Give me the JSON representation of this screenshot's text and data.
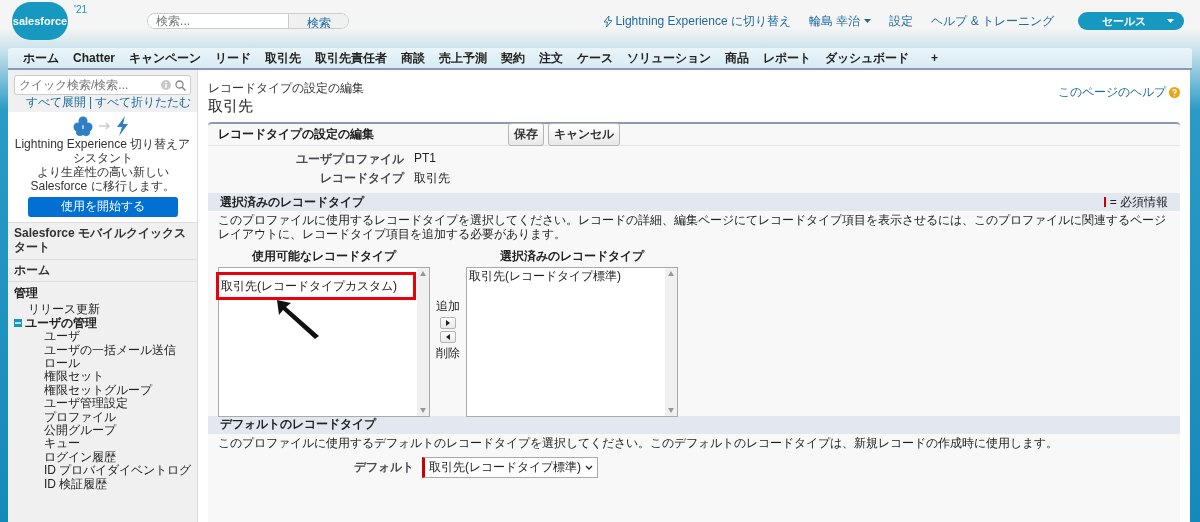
{
  "header": {
    "logo": "salesforce",
    "logo_badge": "'21",
    "search": {
      "placeholder": "検索...",
      "button": "検索"
    },
    "links": [
      {
        "kind": "lightning",
        "label": "Lightning Experience に切り替え"
      },
      {
        "kind": "user",
        "label": "輪島 幸治"
      },
      {
        "kind": "plain",
        "label": "設定"
      },
      {
        "kind": "plain",
        "label": "ヘルプ & トレーニング"
      }
    ],
    "app_menu": "セールス"
  },
  "tabs": [
    {
      "label": "ホーム",
      "selected": false
    },
    {
      "label": "Chatter",
      "selected": false
    },
    {
      "label": "キャンペーン",
      "selected": false
    },
    {
      "label": "リード",
      "selected": false
    },
    {
      "label": "取引先",
      "selected": false
    },
    {
      "label": "取引先責任者",
      "selected": false
    },
    {
      "label": "商談",
      "selected": false
    },
    {
      "label": "売上予測",
      "selected": false
    },
    {
      "label": "契約",
      "selected": false
    },
    {
      "label": "注文",
      "selected": false
    },
    {
      "label": "ケース",
      "selected": false
    },
    {
      "label": "ソリューション",
      "selected": false
    },
    {
      "label": "商品",
      "selected": false
    },
    {
      "label": "レポート",
      "selected": false
    },
    {
      "label": "ダッシュボード",
      "selected": false
    }
  ],
  "add_tab": "+",
  "sidebar": {
    "quick_find": {
      "placeholder": "クイック検索/検索..."
    },
    "expand_all": "すべて展開",
    "link_separator": "|",
    "collapse_all": "すべて折りたたむ",
    "promo": {
      "title": "Lightning Experience 切り替えアシスタント",
      "text": "より生産性の高い新しい Salesforce に移行します。",
      "button": "使用を開始する"
    },
    "sections": [
      "Salesforce モバイルクイックスタート",
      "ホーム"
    ],
    "admin": {
      "title": "管理",
      "items": [
        {
          "label": "リリース更新"
        },
        {
          "label": "ユーザの管理",
          "expanded": true,
          "children": [
            {
              "label": "ユーザ"
            },
            {
              "label": "ユーザの一括メール送信"
            },
            {
              "label": "ロール"
            },
            {
              "label": "権限セット"
            },
            {
              "label": "権限セットグループ"
            },
            {
              "label": "ユーザ管理設定"
            },
            {
              "label": "プロファイル"
            },
            {
              "label": "公開グループ"
            },
            {
              "label": "キュー"
            },
            {
              "label": "ログイン履歴"
            },
            {
              "label": "ID プロバイダイベントログ"
            },
            {
              "label": "ID 検証履歴"
            }
          ]
        }
      ]
    }
  },
  "page": {
    "breadcrumb": "レコードタイプの設定の編集",
    "title": "取引先",
    "help": "このページのヘルプ"
  },
  "panel": {
    "title": "レコードタイプの設定の編集",
    "buttons": [
      "保存",
      "キャンセル"
    ],
    "fields": [
      {
        "label": "ユーザプロファイル",
        "value": "PT1"
      },
      {
        "label": "レコードタイプ",
        "value": "取引先"
      }
    ],
    "selection": {
      "title": "選択済みのレコードタイプ",
      "required_legend": "= 必須情報",
      "description": "このプロファイルに使用するレコードタイプを選択してください。レコードの詳細、編集ページにてレコードタイプ項目を表示させるには、このプロファイルに関連するページレイアウトに、レコードタイプ項目を追加する必要があります。",
      "available": {
        "title": "使用可能なレコードタイプ",
        "items": [
          {
            "label": "取引先(レコードタイプカスタム)",
            "highlighted": true
          }
        ]
      },
      "add": "追加",
      "remove": "削除",
      "chosen": {
        "title": "選択済みのレコードタイプ",
        "items": [
          {
            "label": "取引先(レコードタイプ標準)",
            "highlighted": false
          }
        ]
      }
    },
    "default": {
      "title": "デフォルトのレコードタイプ",
      "description": "このプロファイルに使用するデフォルトのレコードタイプを選択してください。このデフォルトのレコードタイプは、新規レコードの作成時に使用します。",
      "label": "デフォルト",
      "value": "取引先(レコードタイプ標準)"
    }
  }
}
